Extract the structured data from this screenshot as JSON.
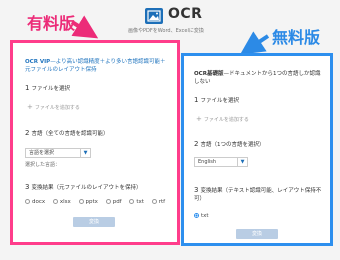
{
  "header": {
    "logo": "OCR",
    "tagline": "画像やPDFをWord、Excelに変換"
  },
  "callouts": {
    "paid": "有料版",
    "free": "無料版"
  },
  "colors": {
    "paid_accent": "#ff3d8b",
    "free_accent": "#2d8fee",
    "brand_blue": "#1d6fb8",
    "button_disabled": "#b9cde4"
  },
  "paid_card": {
    "title_name": "OCR VIP",
    "title_rest": "—より高い認識精度＋より多い言語認識可能＋元ファイルのレイアウト保持",
    "step1_num": "1",
    "step1_label": "ファイルを選択",
    "add_file": "ファイルを追加する",
    "step2_num": "2",
    "step2_label": "言語（全ての言語を認識可能）",
    "language_select": "言語を選択",
    "selected_languages_label": "選択した言語：",
    "step3_num": "3",
    "step3_label": "変換結果（元ファイルのレイアウトを保持）",
    "formats": [
      "docx",
      "xlsx",
      "pptx",
      "pdf",
      "txt",
      "rtf"
    ],
    "convert_button": "変換"
  },
  "free_card": {
    "title_name": "OCR基礎版",
    "title_rest": "—ドキュメントから1つの言語しか認識しない",
    "step1_num": "1",
    "step1_label": "ファイルを選択",
    "add_file": "ファイルを追加する",
    "step2_num": "2",
    "step2_label": "言語（1つの言語を選択）",
    "language_select": "English",
    "step3_num": "3",
    "step3_label": "変換結果（テキスト認識可能、レイアウト保持不可）",
    "formats": [
      "txt"
    ],
    "selected_format": "txt",
    "convert_button": "変換"
  }
}
